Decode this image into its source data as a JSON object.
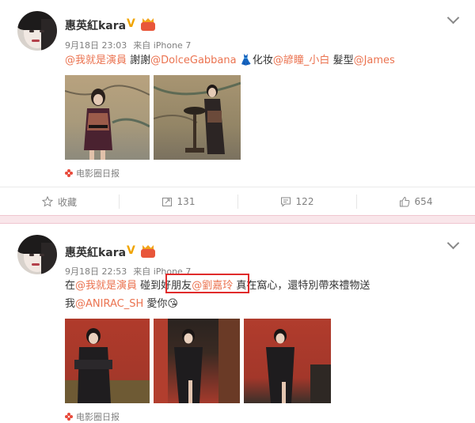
{
  "posts": [
    {
      "name": "惠英紅kara",
      "time": "9月18日 23:03",
      "via": "来自 iPhone 7",
      "text": [
        {
          "t": "@我就是演員",
          "m": true
        },
        {
          "t": " 謝謝",
          "m": false
        },
        {
          "t": "@DolceGabbana",
          "m": true
        },
        {
          "t": " 👗化妆",
          "m": false
        },
        {
          "t": "@諺瞳_小白",
          "m": true
        },
        {
          "t": " 髮型",
          "m": false
        },
        {
          "t": "@James",
          "m": true
        }
      ],
      "source": "电影圈日报",
      "actions": {
        "favorite": "收藏",
        "repost": "131",
        "comment": "122",
        "like": "654"
      }
    },
    {
      "name": "惠英紅kara",
      "time": "9月18日 22:53",
      "via": "来自 iPhone 7",
      "text_line1": [
        {
          "t": "在",
          "m": false
        },
        {
          "t": "@我就是演員",
          "m": true
        },
        {
          "t": " 碰到",
          "m": false
        },
        {
          "t": "好朋友",
          "m": false
        },
        {
          "t": "@劉嘉玲",
          "m": true
        },
        {
          "t": " 真在窩心，還特別帶來禮物送",
          "m": false
        }
      ],
      "text_line2": [
        {
          "t": "我",
          "m": false
        },
        {
          "t": "@ANIRAC_SH",
          "m": true
        },
        {
          "t": " 愛你😘",
          "m": false
        }
      ],
      "source": "电影圈日报"
    }
  ],
  "colors": {
    "accent": "#eb7350",
    "separator": "#f9e6ea",
    "highlight": "#e02b2b"
  }
}
